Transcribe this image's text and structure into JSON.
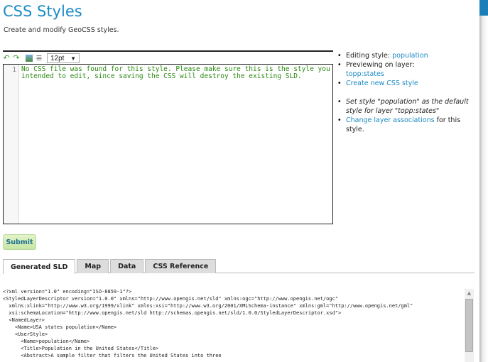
{
  "header": {
    "title": "CSS Styles",
    "subtitle": "Create and modify GeoCSS styles."
  },
  "toolbar": {
    "icons": [
      "undo-icon",
      "redo-icon",
      "image-icon",
      "list-icon"
    ],
    "font_size": "12pt",
    "dropdown_arrow": "▼"
  },
  "editor": {
    "line_number": "1",
    "content": "No CSS file was found for this style. Please make sure this is the style you\nintended to edit, since saving the CSS will destroy the existing SLD."
  },
  "sidebar": {
    "editing_label": "Editing style: ",
    "editing_value": "population",
    "previewing_label": "Previewing on layer:",
    "previewing_value": "topp:states",
    "create_new": "Create new CSS style",
    "set_default": "Set style \"population\" as the default style for layer \"topp:states\"",
    "change_assoc": "Change layer associations",
    "change_assoc_suffix": " for this style."
  },
  "submit_label": "Submit",
  "tabs": [
    {
      "label": "Generated SLD",
      "active": true
    },
    {
      "label": "Map"
    },
    {
      "label": "Data"
    },
    {
      "label": "CSS Reference"
    }
  ],
  "xml": "<?xml version=\"1.0\" encoding=\"ISO-8859-1\"?>\n<StyledLayerDescriptor version=\"1.0.0\" xmlns=\"http://www.opengis.net/sld\" xmlns:ogc=\"http://www.opengis.net/ogc\"\n  xmlns:xlink=\"http://www.w3.org/1999/xlink\" xmlns:xsi=\"http://www.w3.org/2001/XMLSchema-instance\" xmlns:gml=\"http://www.opengis.net/gml\"\n  xsi:schemaLocation=\"http://www.opengis.net/sld http://schemas.opengis.net/sld/1.0.0/StyledLayerDescriptor.xsd\">\n  <NamedLayer>\n    <Name>USA states population</Name>\n    <UserStyle>\n      <Name>population</Name>\n      <Title>Population in the United States</Title>\n      <Abstract>A sample filter that filters the United States into three"
}
